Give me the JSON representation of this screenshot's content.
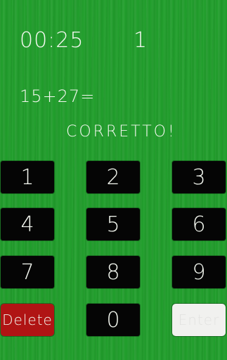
{
  "header": {
    "timer": "00:25",
    "score": "1"
  },
  "question": {
    "expression": "15+27="
  },
  "feedback": {
    "text": "CORRETTO!"
  },
  "keypad": {
    "k1": "1",
    "k2": "2",
    "k3": "3",
    "k4": "4",
    "k5": "5",
    "k6": "6",
    "k7": "7",
    "k8": "8",
    "k9": "9",
    "delete": "Delete",
    "k0": "0",
    "enter": "Enter"
  },
  "colors": {
    "board": "#1f9e2a",
    "key": "#050505",
    "delete": "#b01414",
    "enter": "#f1f1ef"
  }
}
